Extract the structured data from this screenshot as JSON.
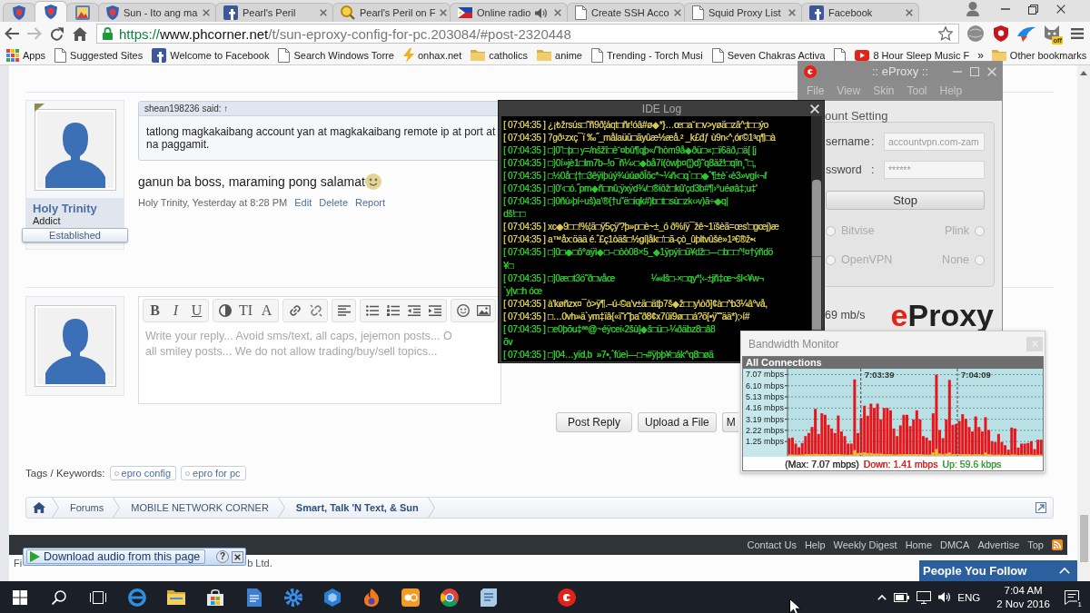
{
  "browser": {
    "tabs": [
      {
        "selected": false,
        "audio": false
      },
      {
        "selected": true,
        "audio": false
      },
      {
        "selected": false,
        "audio": false
      },
      {
        "title": "Sun - Ito ang ma",
        "selected": false,
        "audio": false
      },
      {
        "title": "Pearl's Peril",
        "selected": false,
        "audio": false
      },
      {
        "title": "Pearl's Peril on F",
        "selected": false,
        "audio": false
      },
      {
        "title": "Online radio",
        "selected": false,
        "audio": true
      },
      {
        "title": "Create SSH Acco",
        "selected": false,
        "audio": false
      },
      {
        "title": "Squid Proxy List",
        "selected": false,
        "audio": false
      },
      {
        "title": "Facebook",
        "selected": false,
        "audio": false
      }
    ],
    "back": {
      "disabled": false
    },
    "forward": {
      "disabled": true
    },
    "url": {
      "scheme": "https://",
      "host": "www.phcorner.net",
      "path": "/t/sun-eproxy-config-for-pc.203084/#post-2320448"
    },
    "extension_badge": "off",
    "bookmarks": [
      {
        "kind": "link",
        "label": "Apps"
      },
      {
        "kind": "link",
        "label": "Suggested Sites"
      },
      {
        "kind": "link",
        "label": "Welcome to Facebook"
      },
      {
        "kind": "link",
        "label": "Search Windows Torre"
      },
      {
        "kind": "link",
        "label": "onhax.net"
      },
      {
        "kind": "link",
        "label": "catholics"
      },
      {
        "kind": "link",
        "label": "anime"
      },
      {
        "kind": "link",
        "label": "Trending - Torch Musi"
      },
      {
        "kind": "link",
        "label": "Seven Chakras Activa"
      },
      {
        "kind": "icon"
      },
      {
        "kind": "link",
        "label": "8 Hour Sleep Music F"
      }
    ],
    "bookmarks_overflow": "»",
    "other_bookmarks": "Other bookmarks"
  },
  "forum": {
    "post": {
      "author": "Holy Trinity",
      "user_title": "Addict",
      "banner": "Established",
      "quote": {
        "header": "shean198236 said: ↑",
        "lines": [
          "tatlong magkakaibang account yan at magkakaibang remote ip at port at",
          "na paggamit."
        ]
      },
      "message": "ganun ba boss, maraming pong salamat",
      "meta": "Holy Trinity, Yesterday at 8:28 PM",
      "actions": [
        "Edit",
        "Delete",
        "Report"
      ]
    },
    "editor": {
      "toolbar": [
        [
          {
            "kind": "text",
            "label": "B"
          },
          {
            "kind": "text",
            "label": "I"
          },
          {
            "kind": "text",
            "label": "U"
          }
        ],
        [
          {
            "kind": "icon"
          },
          {
            "kind": "text",
            "label": "TI"
          },
          {
            "kind": "text",
            "label": "A"
          }
        ],
        [
          {
            "kind": "icon"
          },
          {
            "kind": "icon"
          }
        ],
        [
          {
            "kind": "icon"
          }
        ],
        [
          {
            "kind": "icon"
          },
          {
            "kind": "icon"
          },
          {
            "kind": "icon"
          },
          {
            "kind": "icon"
          }
        ],
        [
          {
            "kind": "icon"
          },
          {
            "kind": "icon"
          }
        ]
      ],
      "placeholder": [
        "Write your reply... Avoid sms/text, all caps, jejemon posts... O",
        "all smiley posts... We do not allow trading/buy/sell topics..."
      ]
    },
    "buttons": [
      "Post Reply",
      "Upload a File",
      "M"
    ],
    "tags_label": "Tags / Keywords:",
    "tags": [
      "epro config",
      "epro for pc"
    ],
    "breadcrumbs": [
      {
        "label": "Forums",
        "current": false
      },
      {
        "label": "MOBILE NETWORK CORNER",
        "current": false
      },
      {
        "label": "Smart, Talk 'N Text, & Sun",
        "current": true
      }
    ],
    "footer_links": [
      "Contact Us",
      "Help",
      "Weekly Digest",
      "Home",
      "DMCA",
      "Advertise",
      "Top"
    ],
    "copyright": [
      "Fi",
      "b Ltd."
    ]
  },
  "audio_toolbar": {
    "label": "Download audio from this page",
    "help": "?"
  },
  "people_you_follow": {
    "title": "People You Follow"
  },
  "ide_log": {
    "title": "IDE Log",
    "rows": [
      {
        "text": "[ 07:04:35 ] ¿¡₺žrsús□˜ñ9ð¦áqt□ñr!óâ#ø◆*}…œ□a˘ı□v>yøä□zâ^;t□□ýo",
        "color": "#d9c94c"
      },
      {
        "text": "[ 07:04:35 ] 7gð¹zxç¯ï ‰˝_målaüū□ãyûæ½æå.² _k£đƒ ù9n‹^,ór©1³q¶□à",
        "color": "#d9c94c"
      },
      {
        "text": "[ 07:04:35 ] □]0˜□þ□ y=/nšžî□è˘¤bû¶qþ«/˜hòm9å◆ðü□«;□ï6äð,□ä[ [j",
        "color": "#2bc82b"
      },
      {
        "text": "[ 07:04:35 ] □}0í»jè1□lm7b–!o¯ñ¼›□◆bå7í(òwþ¤(¦)d}˜q8äž!□qîn¸˜□„",
        "color": "#2bc82b"
      },
      {
        "text": "[ 07:04:35 ] □½0å□¦†□3êÿìþúý¾úúøðÎõc*~¼ñ‹□q`□□◆ˆ¶±è˙‹è3»vgí‹¬f",
        "color": "#2bc82b"
      },
      {
        "text": "[ 07:04:35 ] □]0'‹□ó.˝pm◆ñ□nû;ÿxÿd¾/□®iôž□kû'çd3b#¶›°uéøâ‡;u‡'",
        "color": "#2bc82b"
      },
      {
        "text": "[ 07:04:35 ] □]0ñú›þí÷uš)a'®{†u˜ë□iqk#)b□t□sù□zk‹›v)ã÷◆q|",
        "color": "#2bc82b"
      },
      {
        "text": "dš!□□",
        "color": "#2bc82b"
      },
      {
        "text": "[ 07:04:35 ] xc◆9□□!%¦ã□ÿ5çÿ'?þ»p□è~±_ó ð%íÿ¯žê~1ïšèã=œs'□gœj)æ",
        "color": "#d9c94c"
      },
      {
        "text": "[ 07:04:35 ] a™åx:öää é.ˆ£ç1òäš□½gí|åk□'□ã-çò_ûþltvûšè»1²€®ž•‹",
        "color": "#d9c94c"
      },
      {
        "text": "[ 07:04:35 ] □]0□◆□ô°aÿì◆□–□òò08×5_◆1ÿpýí□ü¥dž□—□b□□^!¤†ýñdö",
        "color": "#2bc82b"
      },
      {
        "text": "¥□",
        "color": "#2bc82b"
      },
      {
        "text": "[ 07:04:35 ] □]0æ□t3ö˜ð□våœ                ¼«lš□-×□qy*¦‹-±jñ‡œ~šl<¥w¬",
        "color": "#2bc82b"
      },
      {
        "text": "`y|v□h óœ",
        "color": "#2bc82b"
      },
      {
        "text": "[ 07:04:35 ] à'køñzx¤¯ò>ÿ¶.–ú-©a'v±ä□ätþ7š◆ž□□y\\òð]¢à□^b3¼â°vå,",
        "color": "#d9c94c"
      },
      {
        "text": "[ 07:04:35 ] □…0vh»ä`ym‡ïâ{«ï˜r˜þa˜ð8¢x7ûï9ø□□á?õ[•ÿ˜˜ää*);›í#",
        "color": "#d9c94c"
      },
      {
        "text": "[ 07:04:35 ] □e0þõu‡ªª@~éÿcei‹2šù]◆š□ü□-¼ðäbz8□â8",
        "color": "#2bc82b"
      },
      {
        "text": "õv",
        "color": "#2bc82b"
      },
      {
        "text": "[ 07:04:35 ] □]04…yïd,b  »7•,ˆfúeì—□¬#ÿþþ¥□ák^q8□øä",
        "color": "#2bc82b"
      }
    ]
  },
  "eproxy": {
    "title": ":: eProxy ::",
    "menu": [
      "File",
      "View",
      "Skin",
      "Tool",
      "Help"
    ],
    "section": "ount Setting",
    "fields": [
      {
        "label": "sername",
        "separator": ":",
        "value": "accountvpn.com-zam"
      },
      {
        "label": "ssword",
        "separator": ":",
        "value": "******"
      }
    ],
    "button": "Stop",
    "options": [
      {
        "label": "Bitvise",
        "selected": false,
        "disabled": true
      },
      {
        "label": "Plink",
        "selected": false,
        "disabled": true
      },
      {
        "label": "OpenVPN",
        "selected": false,
        "disabled": true
      },
      {
        "label": "None",
        "selected": false,
        "disabled": true
      }
    ],
    "speed": "69 mb/s",
    "logo": {
      "accent": "e",
      "rest": "Proxy"
    }
  },
  "bandwidth_monitor": {
    "title": "Bandwidth Monitor",
    "chart_data": {
      "type": "bar",
      "title": "All Connections",
      "categories": [
        null,
        null,
        null,
        null,
        null,
        null,
        null,
        null,
        null,
        null,
        null,
        null,
        null,
        null,
        null,
        null,
        null,
        null,
        null,
        null,
        null,
        null,
        null,
        null,
        null,
        null,
        null,
        null,
        null,
        null,
        null,
        null,
        null,
        null,
        null,
        null,
        null,
        null,
        null,
        null,
        null,
        null,
        null,
        null,
        null,
        null,
        null,
        null,
        null,
        null,
        null,
        null,
        null,
        null,
        null,
        null,
        null,
        null,
        null,
        null,
        null,
        null,
        null,
        null,
        null,
        null,
        null,
        null,
        null,
        null,
        null,
        null,
        null,
        null,
        null,
        null,
        null,
        null
      ],
      "series": [
        {
          "color": "#e8161b",
          "values": [
            1.54,
            1.59,
            1.07,
            0.75,
            1.12,
            1.72,
            1.99,
            2.51,
            4.09,
            1.91,
            3.7,
            3.57,
            2.7,
            2.38,
            1.99,
            3.51,
            2.12,
            1.72,
            1.07,
            1.07,
            6.65,
            1.99,
            3.3,
            4.36,
            3.49,
            4.54,
            4.17,
            4.54,
            3.17,
            4.17,
            4.17,
            3.96,
            2.38,
            1.72,
            2.65,
            3.57,
            3.57,
            2.59,
            3.17,
            3.96,
            3.17,
            1.72,
            1.59,
            1.33,
            3.7,
            7.07,
            2.25,
            1.54,
            3.17,
            6.6,
            2.7,
            2.78,
            3.04,
            3.62,
            3.22,
            2.51,
            2.12,
            3.43,
            2.51,
            2.12,
            3.36,
            2.25,
            1.28,
            1.2,
            1.91,
            1.2,
            0.93,
            0.54,
            2.46,
            2.38,
            0.72,
            1.07,
            1.07,
            1.12,
            1.28,
            0.59,
            1.41,
            1.41
          ]
        },
        {
          "color": "#f0c030",
          "values": [
            0.12,
            0.12,
            0.1,
            0.1,
            0.12,
            0.15,
            0.15,
            0.15,
            0.18,
            0.15,
            0.15,
            0.15,
            0.12,
            0.15,
            0.15,
            0.15,
            0.12,
            0.12,
            0.1,
            0.12,
            0.5,
            0.25,
            0.3,
            0.3,
            0.25,
            0.25,
            0.2,
            0.2,
            0.2,
            0.15,
            0.15,
            0.15,
            0.12,
            0.12,
            0.15,
            0.15,
            0.15,
            0.15,
            0.15,
            0.15,
            0.15,
            0.12,
            0.12,
            0.12,
            0.3,
            0.6,
            0.2,
            0.15,
            0.2,
            0.3,
            0.15,
            0.15,
            0.15,
            0.15,
            0.15,
            0.15,
            0.12,
            0.15,
            0.15,
            0.12,
            0.3,
            0.15,
            0.12,
            0.1,
            0.12,
            0.1,
            0.1,
            0.08,
            0.12,
            0.12,
            0.08,
            0.1,
            0.1,
            0.1,
            0.1,
            0.08,
            0.1,
            0.1
          ]
        }
      ],
      "ylim": [
        0,
        7.5
      ],
      "yticks": [
        {
          "value": 1.25,
          "label": "1.25 mbps"
        },
        {
          "value": 2.22,
          "label": "2.22 mbps"
        },
        {
          "value": 3.19,
          "label": "3.19 mbps"
        },
        {
          "value": 4.16,
          "label": "4.16 mbps"
        },
        {
          "value": 5.13,
          "label": "5.13 mbps"
        },
        {
          "value": 6.1,
          "label": "6.10 mbps"
        },
        {
          "value": 7.07,
          "label": "7.07 mbps"
        }
      ],
      "grid": true,
      "annotations": [
        "7:03:39",
        "7:04:09"
      ]
    },
    "readings": [
      {
        "text": "(Max: 7.07 mbps)",
        "color": "#333333"
      },
      {
        "text": "Down: 1.41 mbps",
        "color": "#e0201c"
      },
      {
        "text": "Up: 59.6 kbps",
        "color": "#35a035"
      }
    ]
  },
  "taskbar": {
    "language": "ENG",
    "time": "7:04 AM",
    "date": "2 Nov 2016",
    "notifications": "1"
  }
}
